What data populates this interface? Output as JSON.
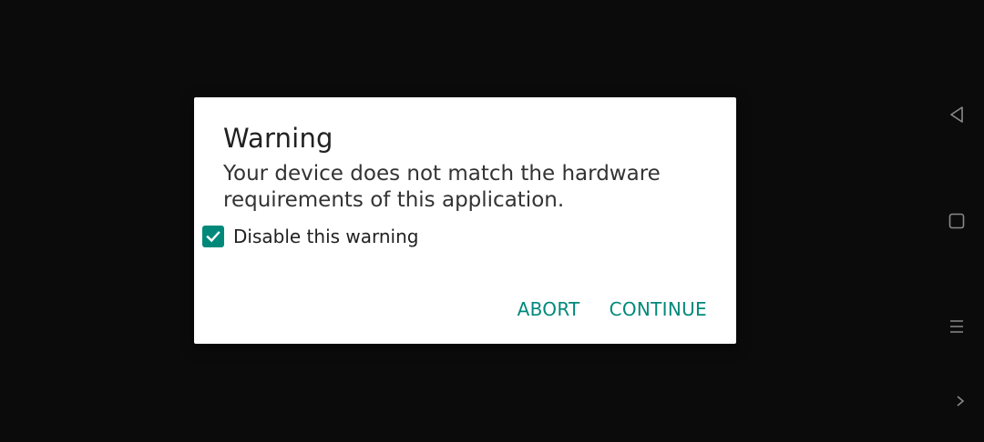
{
  "dialog": {
    "title": "Warning",
    "message": "Your device does not match the hardware requirements of this application.",
    "checkbox": {
      "label": "Disable this warning",
      "checked": true
    },
    "buttons": {
      "abort": "ABORT",
      "continue": "CONTINUE"
    }
  },
  "navigation_bar": {
    "icons": [
      "back-icon",
      "home-icon",
      "menu-icon",
      "chevron-right-icon"
    ]
  },
  "colors": {
    "background": "#0b0b0b",
    "dialog": "#ffffff",
    "accent": "#00897b"
  }
}
